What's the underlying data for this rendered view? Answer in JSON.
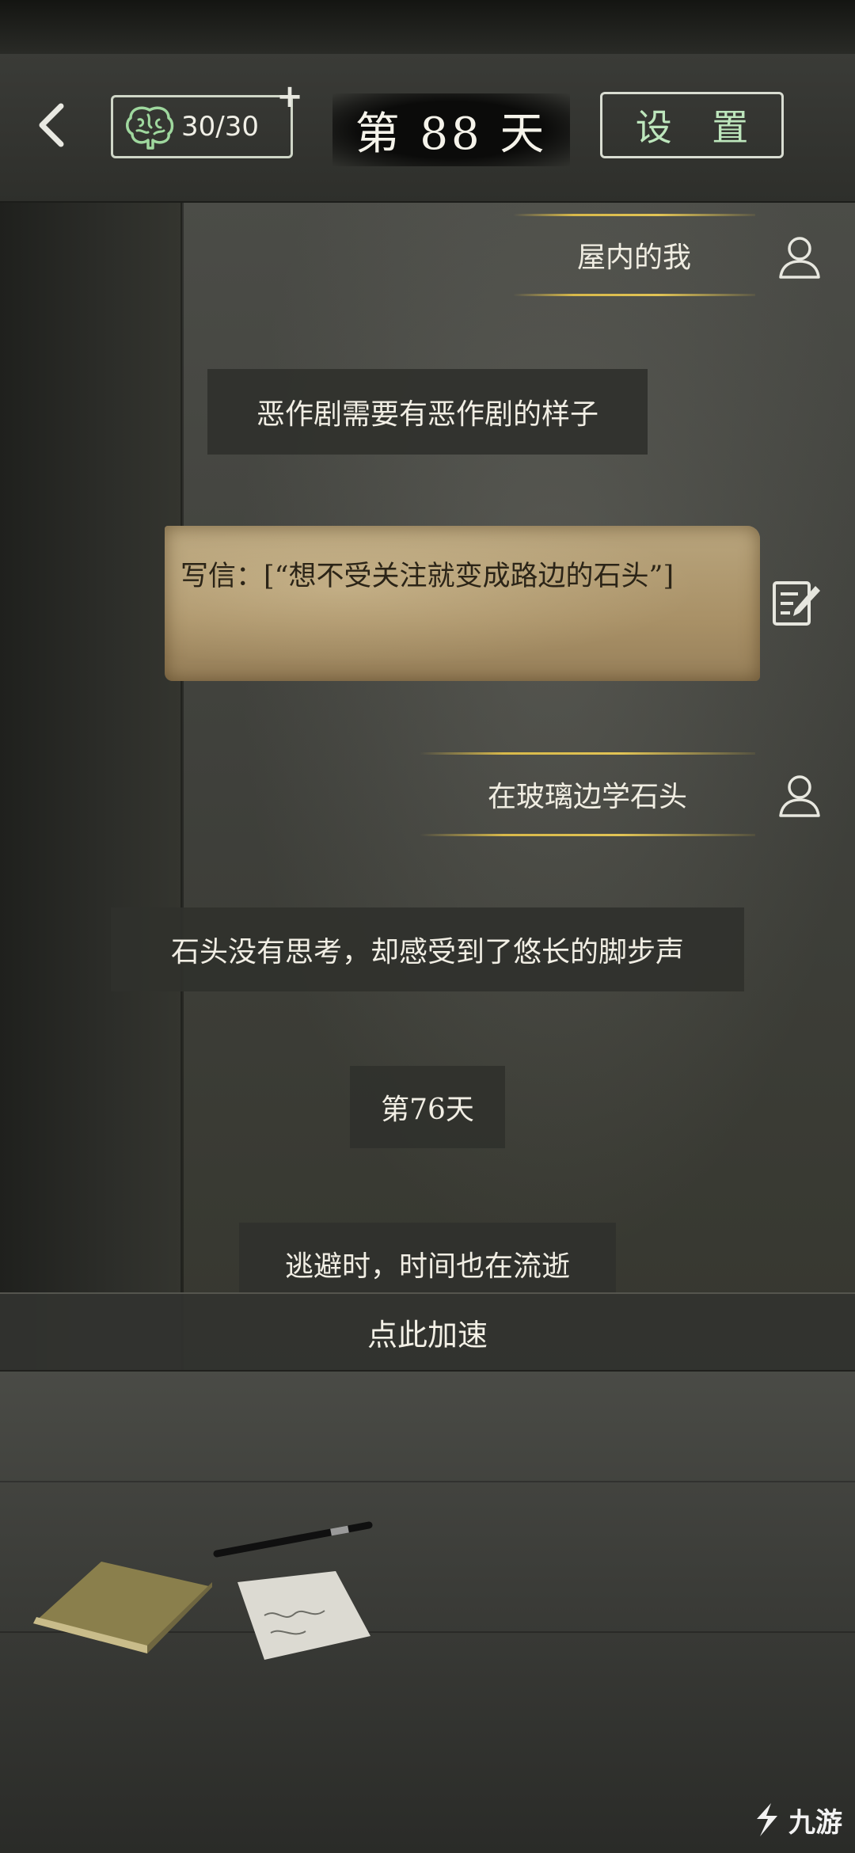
{
  "header": {
    "brain_count": "30/30",
    "day_label": "第 88 天",
    "settings_label": "设 置"
  },
  "feed": {
    "player_action_1": "屋内的我",
    "narration_1": "恶作剧需要有恶作剧的样子",
    "letter_text": "写信：[“想不受关注就变成路边的石头”]",
    "player_action_2": "在玻璃边学石头",
    "narration_2": "石头没有思考，却感受到了悠长的脚步声",
    "day_marker": "第76天",
    "narration_3": "逃避时，时间也在流逝"
  },
  "speed_button": "点此加速",
  "icons": [
    "back-icon",
    "brain-icon",
    "plus-icon",
    "user-icon",
    "edit-icon",
    "notebook-icon",
    "pen-icon",
    "paper-note-icon",
    "watermark-logo-icon"
  ],
  "watermark": "九游",
  "colors": {
    "settings_text": "#bde6bc",
    "gold_line": "#d8b94a",
    "letter_paper": "#a99167"
  }
}
